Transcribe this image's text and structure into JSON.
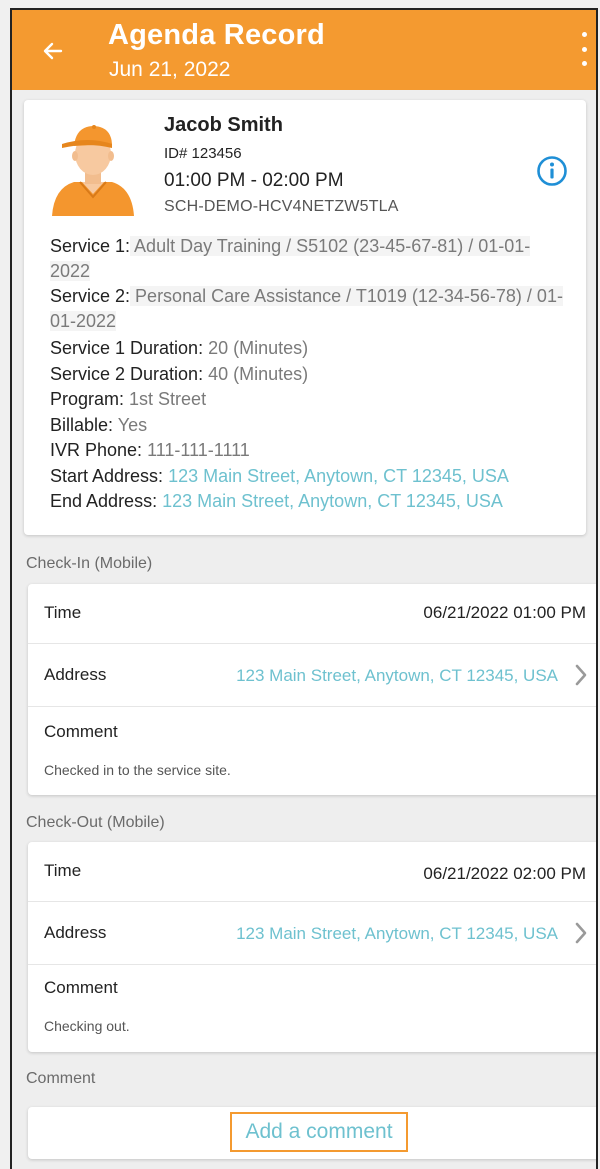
{
  "appbar": {
    "title": "Agenda Record",
    "date": "Jun 21, 2022",
    "back_icon": "arrow-left-icon",
    "menu_icon": "more-vertical-icon"
  },
  "client": {
    "name": "Jacob Smith",
    "id": "ID# 123456",
    "time_range": "01:00 PM - 02:00 PM",
    "schedule_id": "SCH-DEMO-HCV4NETZW5TLA",
    "info_icon": "info-icon"
  },
  "details": {
    "service1_label": "Service 1:",
    "service1_value": " Adult Day Training / S5102 (23-45-67-81) / 01-01-2022",
    "service2_label": "Service 2:",
    "service2_value": " Personal Care Assistance / T1019 (12-34-56-78) / 01-01-2022",
    "service1_duration_label": "Service 1 Duration:",
    "service1_duration_value": " 20 (Minutes)",
    "service2_duration_label": "Service 2 Duration:",
    "service2_duration_value": " 40 (Minutes)",
    "program_label": "Program:",
    "program_value": " 1st Street",
    "billable_label": "Billable:",
    "billable_value": " Yes",
    "ivr_label": "IVR Phone:",
    "ivr_value": " 111-111-1111",
    "start_address_label": "Start Address:",
    "start_address_value": " 123 Main Street, Anytown, CT 12345, USA",
    "end_address_label": "End Address:",
    "end_address_value": " 123 Main Street, Anytown, CT 12345, USA"
  },
  "checkin": {
    "section_title": "Check-In (Mobile)",
    "time_label": "Time",
    "time_value": "06/21/2022 01:00 PM",
    "address_label": "Address",
    "address_value": "123 Main Street, Anytown, CT 12345, USA",
    "comment_label": "Comment",
    "comment_value": "Checked in to the service site."
  },
  "checkout": {
    "section_title": "Check-Out (Mobile)",
    "time_label": "Time",
    "time_value": "06/21/2022 02:00 PM",
    "address_label": "Address",
    "address_value": "123 Main Street, Anytown, CT 12345, USA",
    "comment_label": "Comment",
    "comment_value": "Checking out."
  },
  "comment_section": {
    "section_title": "Comment",
    "add_button_label": "Add a comment"
  },
  "colors": {
    "accent": "#f49a30",
    "link": "#6ec1cf",
    "info": "#1f8fd6"
  }
}
